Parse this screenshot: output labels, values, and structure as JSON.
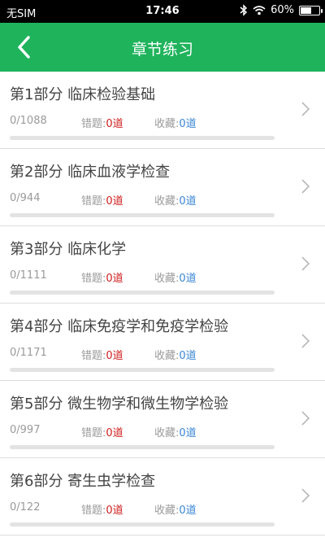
{
  "status_bar": {
    "carrier": "无SIM",
    "time": "17:46",
    "battery_pct": "60%",
    "battery_level": 0.6,
    "icons": [
      "bluetooth-icon",
      "wifi-icon",
      "battery-icon"
    ]
  },
  "nav": {
    "title": "章节练习",
    "back_icon": "chevron-left-icon"
  },
  "labels": {
    "wrong": "错题:",
    "fav": "收藏:"
  },
  "chapters": [
    {
      "name": "第1部分  临床检验基础",
      "progress": "0/1088",
      "wrong": "0道",
      "fav": "0道",
      "done_fraction": 0
    },
    {
      "name": "第2部分  临床血液学检查",
      "progress": "0/944",
      "wrong": "0道",
      "fav": "0道",
      "done_fraction": 0
    },
    {
      "name": "第3部分  临床化学",
      "progress": "0/1111",
      "wrong": "0道",
      "fav": "0道",
      "done_fraction": 0
    },
    {
      "name": "第4部分  临床免疫学和免疫学检验",
      "progress": "0/1171",
      "wrong": "0道",
      "fav": "0道",
      "done_fraction": 0
    },
    {
      "name": "第5部分  微生物学和微生物学检验",
      "progress": "0/997",
      "wrong": "0道",
      "fav": "0道",
      "done_fraction": 0
    },
    {
      "name": "第6部分  寄生虫学检查",
      "progress": "0/122",
      "wrong": "0道",
      "fav": "0道",
      "done_fraction": 0
    }
  ],
  "colors": {
    "primary": "#1fb35c",
    "wrong_value": "#d02020",
    "fav_value": "#3a86d4"
  }
}
